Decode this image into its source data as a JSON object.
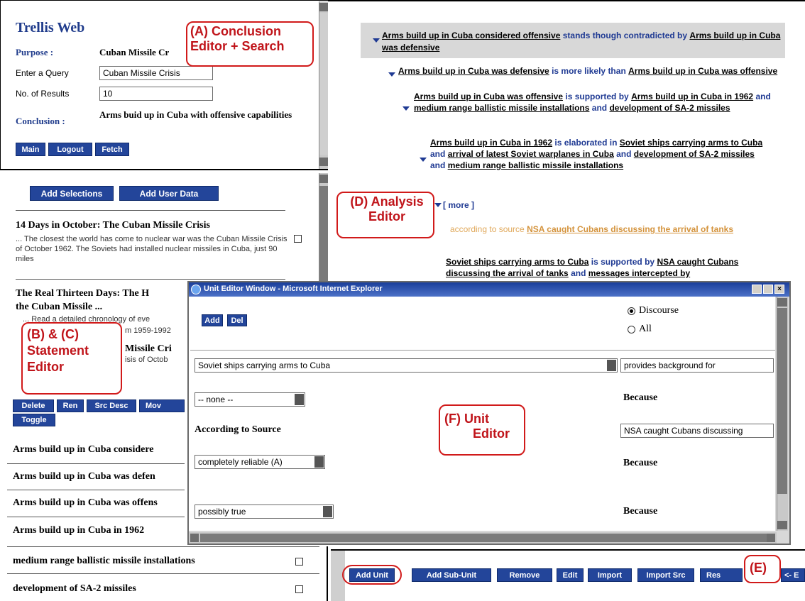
{
  "panel_a": {
    "brand": "Trellis Web",
    "purpose_label": "Purpose :",
    "purpose_value": "Cuban Missile Cr",
    "query_label": "Enter a Query",
    "query_value": "Cuban Missile Crisis",
    "results_label": "No. of Results",
    "results_value": "10",
    "conclusion_label": "Conclusion :",
    "conclusion_value": "Arms buid up in Cuba with offensive capabilities",
    "buttons": [
      "Main",
      "Logout",
      "Fetch"
    ]
  },
  "panel_b": {
    "add_selections": "Add Selections",
    "add_user_data": "Add User Data",
    "results": [
      {
        "title": "14 Days in October: The Cuban Missile Crisis",
        "snippet": "... The closest the world has come to nuclear war was the Cuban Missile Crisis of October 1962. The Soviets had installed nuclear missiles in Cuba, just 90 miles"
      },
      {
        "title": "The Real Thirteen Days: The H",
        "title2": "the Cuban Missile ...",
        "snippet": "... Read a detailed chronology of eve",
        "snippet2": "m 1959-1992"
      },
      {
        "title": "Missile Cri",
        "snippet": "isis of Octob"
      }
    ]
  },
  "panel_c": {
    "buttons": [
      "Delete",
      "Ren",
      "Src Desc",
      "Mov",
      "Toggle"
    ],
    "statements": [
      "Arms build up in Cuba considere",
      "Arms build up in Cuba was defen",
      "Arms build up in Cuba was offens",
      "Arms build up in Cuba in 1962",
      "medium range ballistic missile installations",
      "development of SA-2 missiles"
    ]
  },
  "panel_d": {
    "root_claim": "Arms build up in Cuba considered offensive",
    "root_rel": "stands though contradicted by",
    "root_target": "Arms build up in Cuba was defensive",
    "n1_claim": "Arms build up in Cuba was defensive",
    "n1_rel": "is more likely than",
    "n1_target": "Arms build up in Cuba was offensive",
    "n2_claim": "Arms build up in Cuba was offensive",
    "n2_rel": "is supported by",
    "n2_t1": "Arms build up in Cuba in 1962",
    "n2_and": "and",
    "n2_t2": "medium range ballistic missile installations",
    "n2_t3": "development of SA-2 missiles",
    "n3_claim": "Arms build up in Cuba in 1962",
    "n3_rel": "is elaborated in",
    "n3_t1": "Soviet ships carrying arms to Cuba",
    "n3_t2": "arrival of latest Soviet warplanes in Cuba",
    "n3_t3": "development of SA-2 missiles",
    "n3_t4": "medium range ballistic missile installations",
    "more": "[ more ]",
    "source_prefix": "according to source",
    "source_link": "NSA caught Cubans discussing the arrival of tanks",
    "n4_claim": "Soviet ships carrying arms to Cuba",
    "n4_rel": "is supported by",
    "n4_t1": "NSA caught Cubans discussing the arrival of tanks",
    "n4_t2": "messages intercepted by"
  },
  "panel_e": {
    "buttons": [
      "Add Unit",
      "Add Sub-Unit",
      "Remove",
      "Edit",
      "Import",
      "Import Src",
      "Res",
      "<- E"
    ]
  },
  "unit_editor": {
    "window_title": "Unit Editor Window - Microsoft Internet Explorer",
    "add": "Add",
    "del": "Del",
    "radio_discourse": "Discourse",
    "radio_all": "All",
    "unit_select": "Soviet ships carrying arms to Cuba",
    "relation_value": "provides background for",
    "none_select": "-- none --",
    "because": "Because",
    "according_to_source": "According to Source",
    "source_value": "NSA caught Cubans discussing",
    "reliability": "completely reliable (A)",
    "credibility": "possibly true"
  },
  "annotations": {
    "a": "(A) Conclusion Editor + Search",
    "a1": "(A) Conclusion",
    "a2": "Editor + Search",
    "bc1": "(B) & (C)",
    "bc2": "Statement",
    "bc3": "Editor",
    "d1": "(D) Analysis",
    "d2": "Editor",
    "f1": "(F) Unit",
    "f2": "Editor",
    "e": "(E)"
  },
  "colors": {
    "button_blue": "#23459a",
    "annotation_red": "#c0141a",
    "relation_blue": "#1f3a93",
    "source_orange": "#d4933c"
  }
}
